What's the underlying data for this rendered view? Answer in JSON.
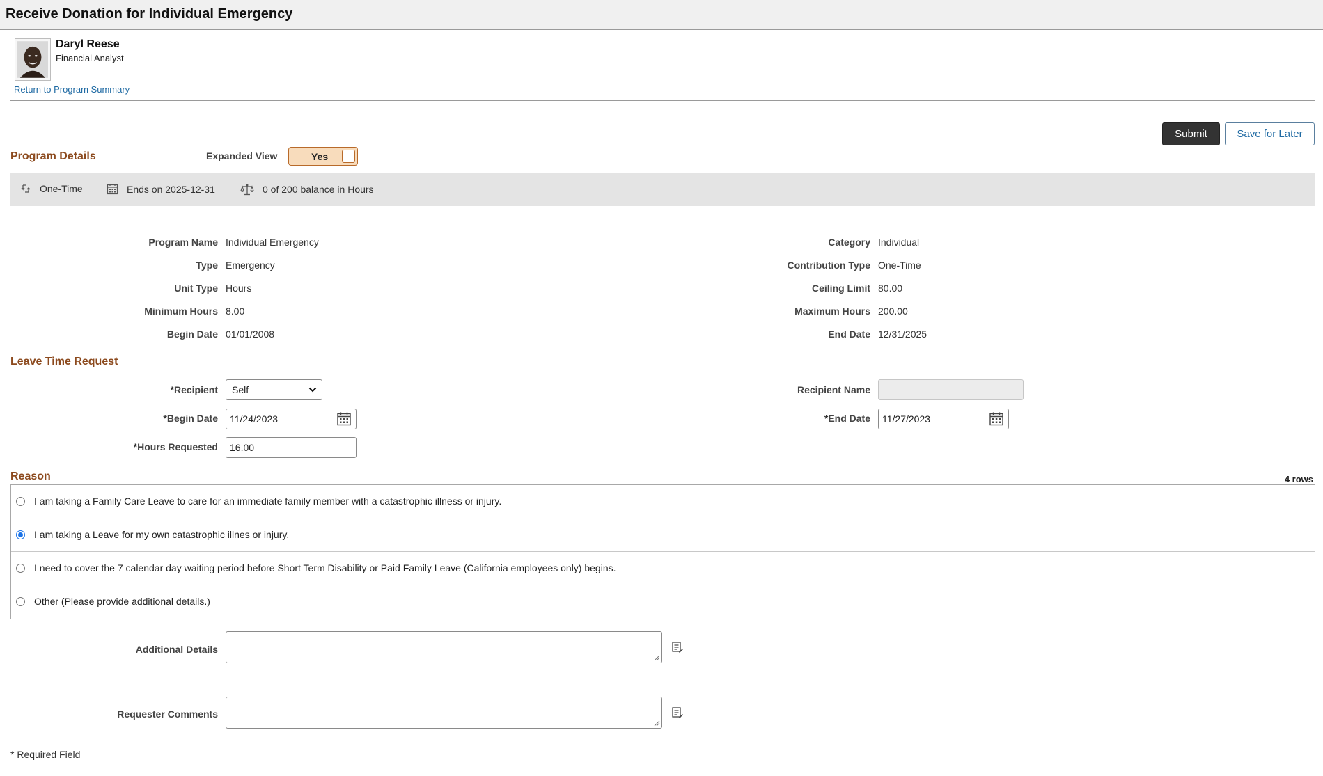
{
  "page": {
    "title": "Receive Donation for Individual Emergency"
  },
  "employee": {
    "name": "Daryl Reese",
    "job_title": "Financial Analyst",
    "return_link": "Return to Program Summary"
  },
  "actions": {
    "submit_label": "Submit",
    "save_later_label": "Save for Later"
  },
  "program_details": {
    "section_title": "Program Details",
    "expanded_view_label": "Expanded View",
    "expanded_view_value": "Yes",
    "summary_band": {
      "frequency": "One-Time",
      "ends_on": "Ends on 2025-12-31",
      "balance": "0 of 200 balance in Hours"
    },
    "fields_left": [
      {
        "label": "Program Name",
        "value": "Individual Emergency"
      },
      {
        "label": "Type",
        "value": "Emergency"
      },
      {
        "label": "Unit Type",
        "value": "Hours"
      },
      {
        "label": "Minimum Hours",
        "value": "8.00"
      },
      {
        "label": "Begin Date",
        "value": "01/01/2008"
      }
    ],
    "fields_right": [
      {
        "label": "Category",
        "value": "Individual"
      },
      {
        "label": "Contribution Type",
        "value": "One-Time"
      },
      {
        "label": "Ceiling Limit",
        "value": "80.00"
      },
      {
        "label": "Maximum Hours",
        "value": "200.00"
      },
      {
        "label": "End Date",
        "value": "12/31/2025"
      }
    ]
  },
  "leave_request": {
    "section_title": "Leave Time Request",
    "recipient_label": "Recipient",
    "recipient_value": "Self",
    "recipient_name_label": "Recipient Name",
    "recipient_name_value": "",
    "begin_date_label": "Begin Date",
    "begin_date_value": "11/24/2023",
    "end_date_label": "End Date",
    "end_date_value": "11/27/2023",
    "hours_label": "Hours Requested",
    "hours_value": "16.00"
  },
  "reason": {
    "section_title": "Reason",
    "rows_count": "4 rows",
    "options": [
      {
        "text": "I am taking a Family Care Leave to care for an immediate family member with a catastrophic illness or injury.",
        "selected": false
      },
      {
        "text": "I am taking a Leave for my own catastrophic illnes or injury.",
        "selected": true
      },
      {
        "text": "I need to cover the 7 calendar day waiting period before Short Term Disability or Paid Family Leave (California employees only) begins.",
        "selected": false
      },
      {
        "text": "Other (Please provide additional details.)",
        "selected": false
      }
    ],
    "additional_details_label": "Additional Details",
    "requester_comments_label": "Requester Comments"
  },
  "footer": {
    "required_note": "* Required Field"
  },
  "colors": {
    "section_title": "#8c4a1e",
    "link": "#1f6aa3",
    "toggle_bg": "#f8dcbc",
    "band_bg": "#e4e4e4",
    "submit_bg": "#333333"
  }
}
